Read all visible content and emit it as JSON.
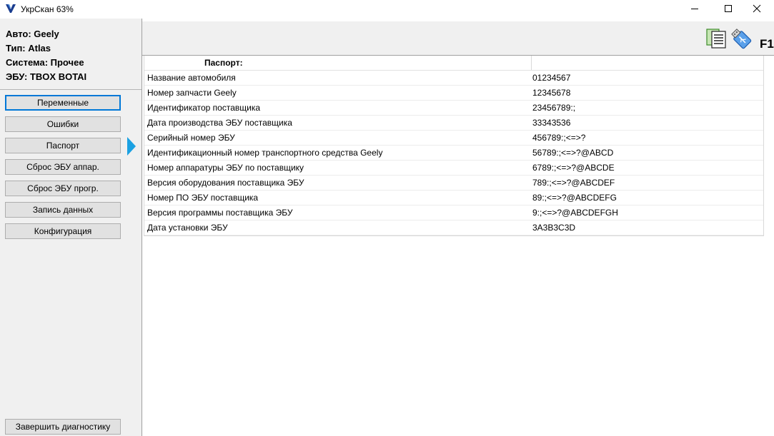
{
  "window": {
    "title": "УкрСкан 63%",
    "icons": {
      "app": "ukrscan-logo-icon",
      "minimize": "minimize-icon",
      "maximize": "maximize-icon",
      "close": "close-icon"
    }
  },
  "vehicle": {
    "auto": "Авто: Geely",
    "type": "Тип: Atlas",
    "system": "Система: Прочее",
    "ecu": "ЭБУ: TBOX BOTAI"
  },
  "nav": {
    "items": [
      {
        "label": "Переменные",
        "active": true
      },
      {
        "label": "Ошибки",
        "active": false
      },
      {
        "label": "Паспорт",
        "active": false
      },
      {
        "label": "Сброс ЭБУ аппар.",
        "active": false
      },
      {
        "label": "Сброс ЭБУ прогр.",
        "active": false
      },
      {
        "label": "Запись данных",
        "active": false
      },
      {
        "label": "Конфигурация",
        "active": false
      }
    ],
    "current": "Паспорт",
    "finish": "Завершить диагностику",
    "arrow_icon": "triangle-right-icon"
  },
  "toolbar": {
    "report_icon": "document-report-icon",
    "usb_icon": "usb-connection-icon",
    "help": "F1"
  },
  "passport": {
    "header": "Паспорт:",
    "rows": [
      {
        "name": "Название автомобиля",
        "value": "01234567"
      },
      {
        "name": "Номер запчасти Geely",
        "value": "12345678"
      },
      {
        "name": "Идентификатор поставщика",
        "value": "23456789:;"
      },
      {
        "name": "Дата производства ЭБУ поставщика",
        "value": "33343536"
      },
      {
        "name": "Серийный номер ЭБУ",
        "value": "456789:;<=>?"
      },
      {
        "name": "Идентификационный номер транспортного средства Geely",
        "value": "56789:;<=>?@ABCD"
      },
      {
        "name": "Номер аппаратуры ЭБУ по поставщику",
        "value": "6789:;<=>?@ABCDE"
      },
      {
        "name": "Версия оборудования поставщика ЭБУ",
        "value": "789:;<=>?@ABCDEF"
      },
      {
        "name": "Номер ПО ЭБУ поставщика",
        "value": "89:;<=>?@ABCDEFG"
      },
      {
        "name": "Версия программы поставщика ЭБУ",
        "value": "9:;<=>?@ABCDEFGH"
      },
      {
        "name": "Дата установки ЭБУ",
        "value": "3A3B3C3D"
      }
    ]
  },
  "colors": {
    "accent": "#0078d7",
    "panel": "#f0f0f0",
    "button": "#e1e1e1",
    "arrow": "#1ba1e2"
  }
}
